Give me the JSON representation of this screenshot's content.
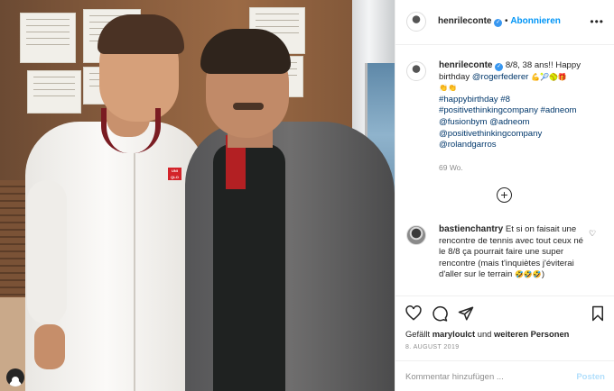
{
  "post": {
    "username": "henrileconte",
    "verified_icon": "verified-badge-icon",
    "follow_label": "Abonnieren",
    "more_label": "•••",
    "caption": {
      "text_line1": "8/8, 38 ans!! Happy",
      "text_line2a": "birthday",
      "mention_federer": "@rogerfederer",
      "emojis_line2": "💪🎾🥎🎁",
      "emojis_line3": "👏👏",
      "hashtags": [
        "#happybirthday #8",
        "#positivethinkingcompany #adneom",
        "@fusionbym @adneom",
        "@positivethinkingcompany",
        "@rolandgarros"
      ]
    },
    "time_ago": "69 Wo.",
    "load_more_icon": "plus-circle-icon"
  },
  "comment": {
    "username": "bastienchantry",
    "text": "Et si on faisait une rencontre de tennis avec tout ceux né le 8/8 ça pourrait faire une super rencontre (mais t'inquiètes j'éviterai d'aller sur le terrain",
    "emojis": "🤣🤣🤣",
    "close_paren": ")"
  },
  "actions": {
    "like_icon": "heart-icon",
    "comment_icon": "comment-bubble-icon",
    "share_icon": "paper-plane-icon",
    "save_icon": "bookmark-icon",
    "likes_prefix": "Gefällt",
    "likes_user": "maryloulct",
    "likes_joiner": "und",
    "likes_others": "weiteren Personen",
    "date": "8. AUGUST 2019"
  },
  "add_comment": {
    "placeholder": "Kommentar hinzufügen ...",
    "post_label": "Posten"
  },
  "photo": {
    "logo_text": "UNI QLO"
  },
  "colors": {
    "link": "#00376b",
    "follow": "#0095f6",
    "muted": "#8e8e8e",
    "post_disabled": "#b2dffc"
  }
}
